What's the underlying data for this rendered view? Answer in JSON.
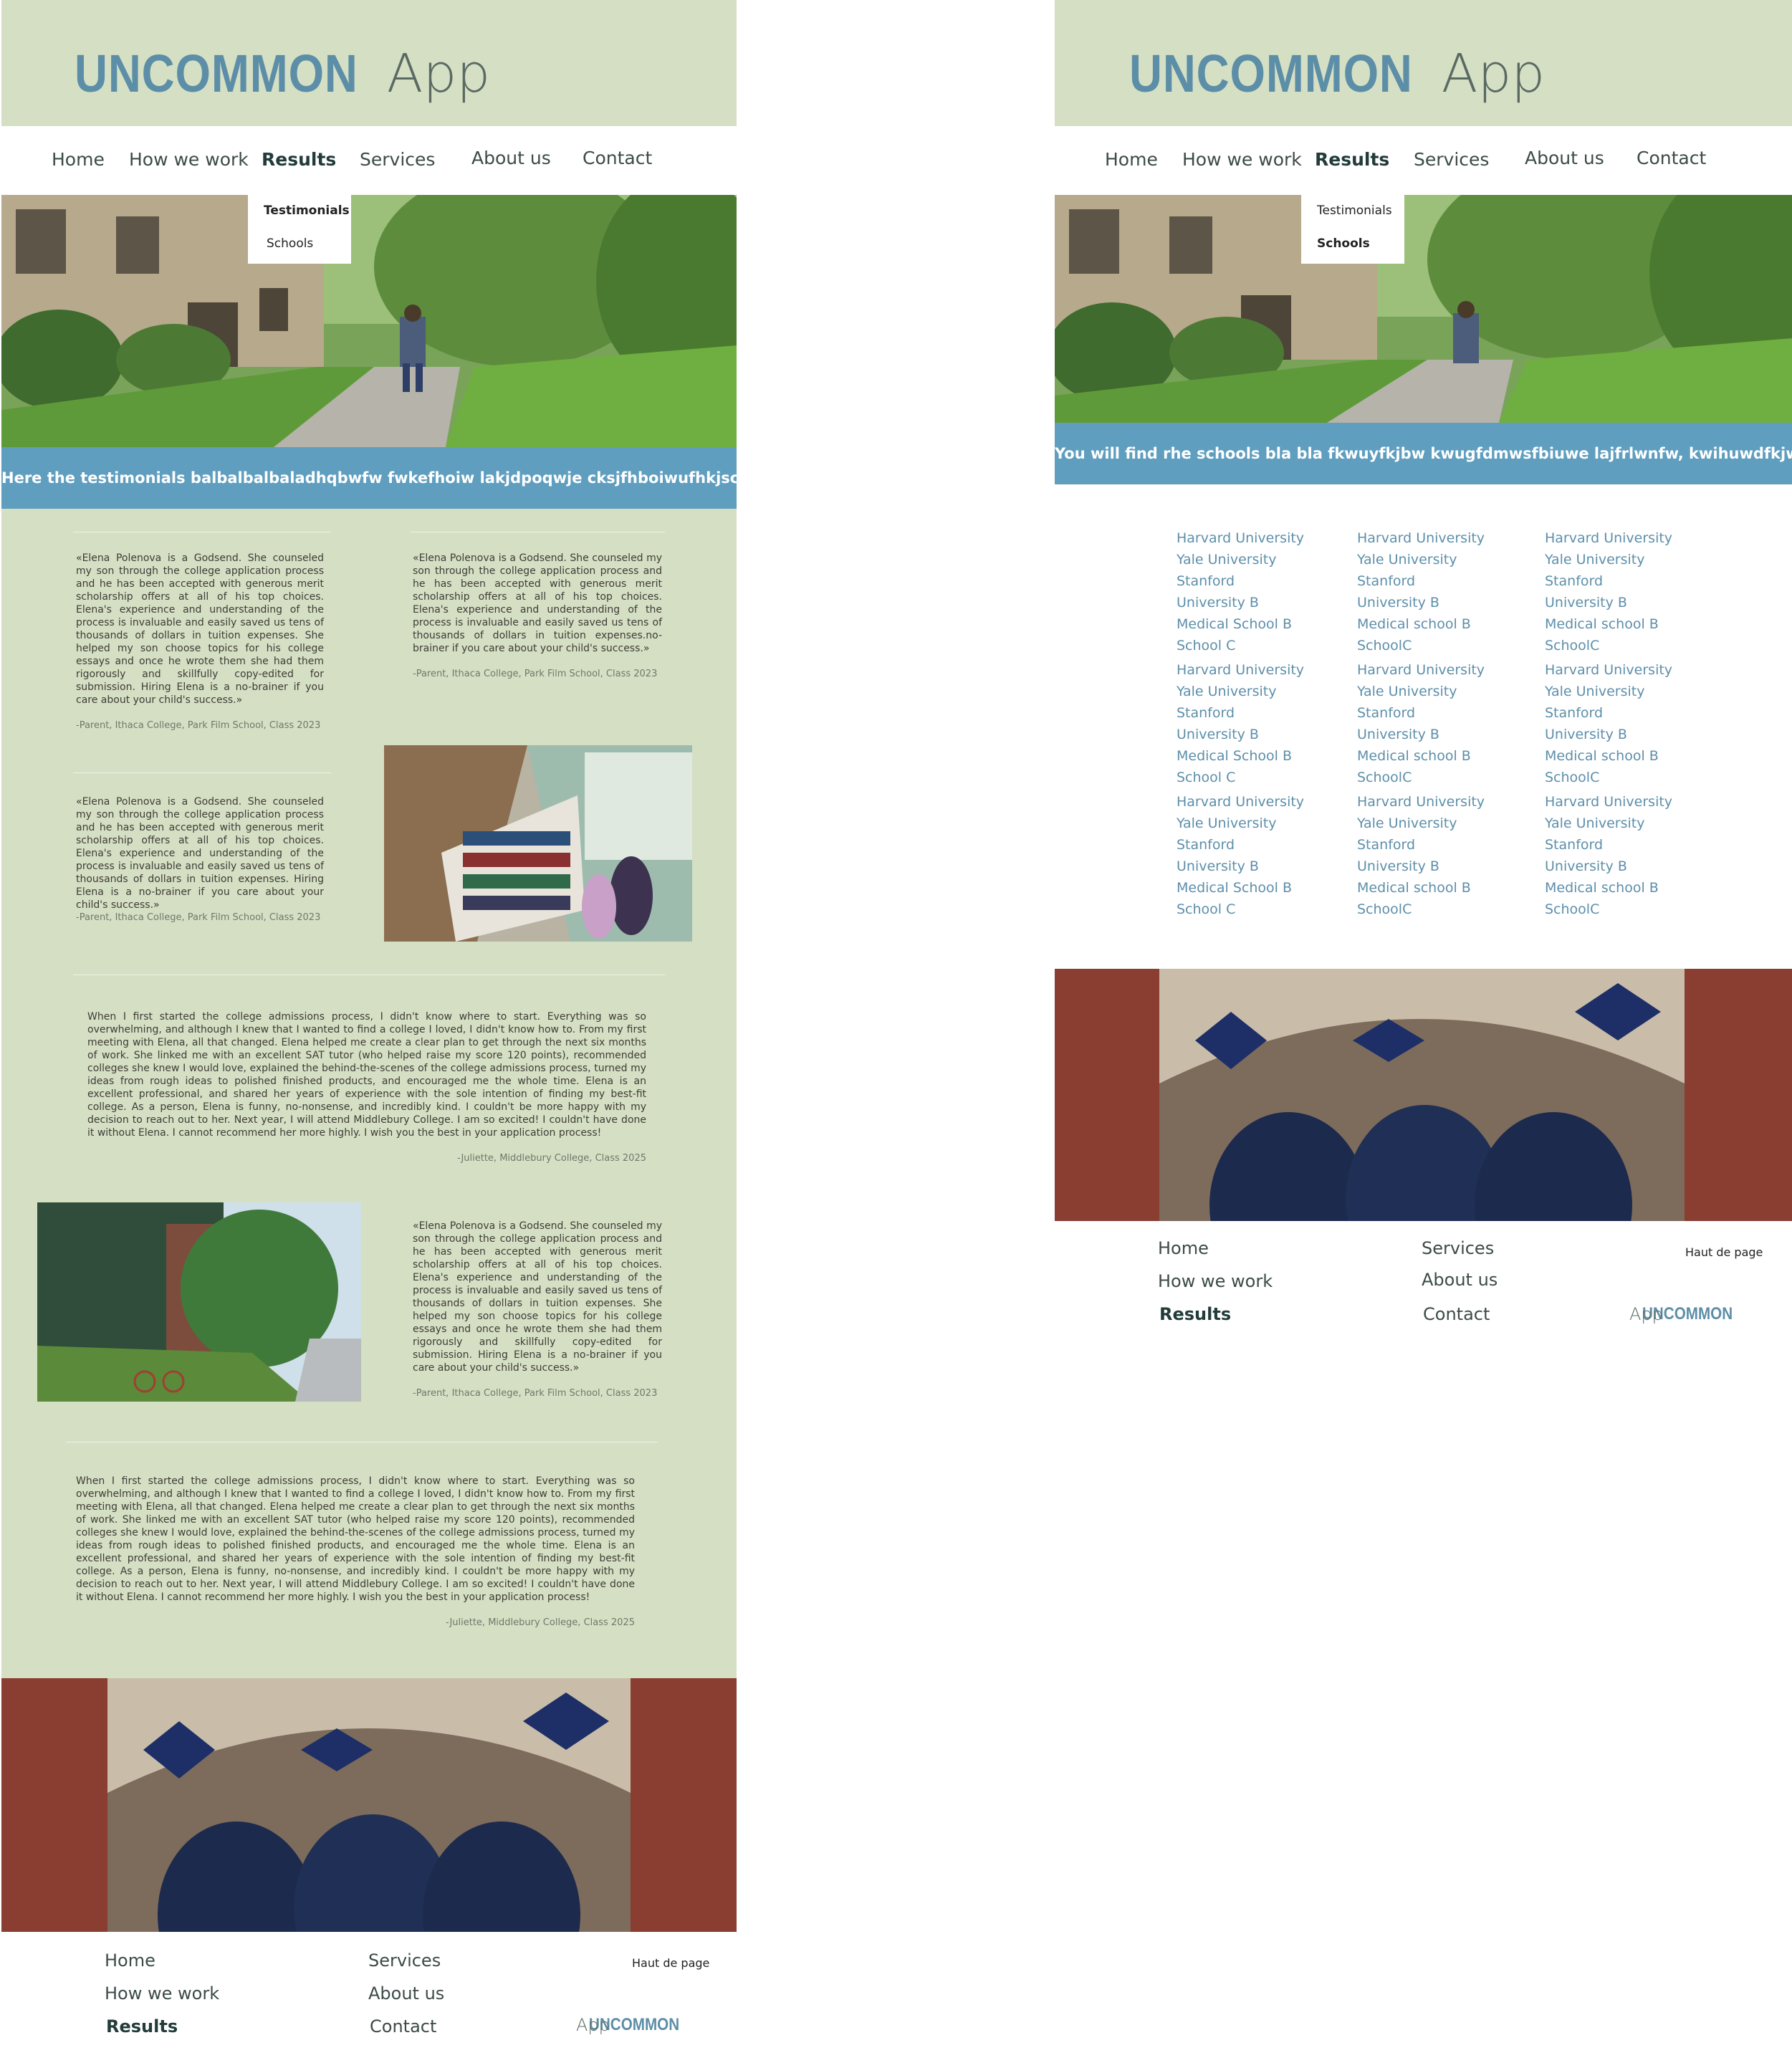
{
  "brand": {
    "name": "UNCOMMON",
    "suffix": "App"
  },
  "nav": {
    "home": "Home",
    "how": "How we work",
    "results": "Results",
    "services": "Services",
    "about": "About us",
    "contact": "Contact"
  },
  "dropdown": {
    "testimonials": "Testimonials",
    "schools": "Schools"
  },
  "testimonials_page": {
    "banner": "Here the testimonials balbalbalbaladhqbwfw fwkefhoiw lakjdpoqwje cksjfhboiwufhkjsc",
    "quote_long": "«Elena Polenova is a Godsend. She counseled my son through the college application process and he has been accepted with generous merit scholarship offers at all of his top choices. Elena's experience and understanding of the process is invaluable and easily saved us tens of thousands of dollars in tuition expenses. She helped my son choose topics for his college essays and once he wrote them she had them rigorously and skillfully copy-edited for submission. Hiring Elena is a no-brainer if you care about your child's success.»",
    "quote_short": "«Elena Polenova is a Godsend. She counseled my son through the college application process and he has been accepted with generous merit scholarship offers at all of his top choices. Elena's experience and understanding of the process is invaluable and easily saved us tens of thousands of dollars in tuition expenses.no-brainer if you care about your child's success.»",
    "quote_mid": "«Elena Polenova is a Godsend. She counseled my son through the college application process and he has been accepted with generous merit scholarship offers at all of his top choices. Elena's experience and understanding of the process is invaluable and easily saved us tens of thousands of dollars in tuition expenses. Hiring Elena is a no-brainer if you care about your child's success.»",
    "parent_attr": "-Parent, Ithaca College, Park Film School, Class 2023",
    "juliette_quote": "When I first started the college admissions process, I didn't know where to start. Everything was so overwhelming, and although I knew that I wanted to find a college I loved, I didn't know how to. From my first meeting with Elena, all that changed. Elena helped me create a clear plan to get through the next six months of work. She linked me with an excellent SAT tutor (who helped raise my score 120 points), recommended colleges she knew I would love, explained the behind-the-scenes of the college admissions process, turned my ideas from rough ideas to polished finished products, and encouraged me the whole time. Elena is an excellent professional, and shared her years of experience with the sole intention of finding my best-fit college. As a person, Elena is funny, no-nonsense, and incredibly kind. I couldn't be more happy with my decision to reach out to her. Next year, I will attend Middlebury College. I am so excited! I couldn't have done it without Elena. I cannot recommend her more highly. I wish you the best in your application process!",
    "juliette_attr": "-Juliette, Middlebury College, Class 2025"
  },
  "schools_page": {
    "banner": "You will find rhe schools bla bla fkwuyfkjbw kwugfdmwsfbiuwe lajfrlwnfw, kwihuwdfkjw",
    "col1": [
      "Harvard University",
      "Yale University",
      "Stanford",
      "University B",
      "Medical School B",
      "School C"
    ],
    "col2": [
      "Harvard University",
      "Yale University",
      "Stanford",
      "University B",
      "Medical school B",
      "SchoolC"
    ],
    "col3": [
      "Harvard University",
      "Yale University",
      "Stanford",
      "University B",
      "Medical school B",
      "SchoolC"
    ]
  },
  "footer": {
    "home": "Home",
    "how": "How we work",
    "results": "Results",
    "services": "Services",
    "about": "About us",
    "contact": "Contact",
    "top": "Haut de page"
  },
  "colors": {
    "sage": "#d5dfc4",
    "banner": "#5f9ebf",
    "brand_blue": "#5c8ea7",
    "link": "#5d8faa"
  }
}
